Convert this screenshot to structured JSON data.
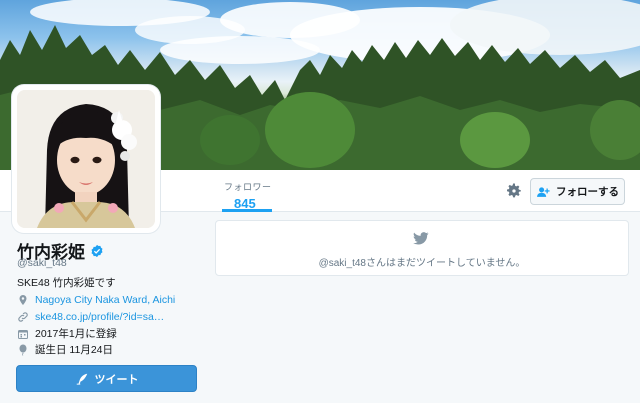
{
  "profile": {
    "name": "竹内彩姫",
    "handle": "@saki_t48",
    "bio": "SKE48 竹内彩姫です",
    "location": "Nagoya City Naka Ward, Aichi",
    "website": "ske48.co.jp/profile/?id=sa…",
    "joined": "2017年1月に登録",
    "birthday": "誕生日 11月24日",
    "verified": true
  },
  "nav": {
    "stats": [
      {
        "label": "フォロワー",
        "value": "845"
      }
    ],
    "follow_label": "フォローする"
  },
  "timeline": {
    "empty_message": "@saki_t48さんはまだツイートしていません。"
  },
  "actions": {
    "tweet_label": "ツイート"
  },
  "colors": {
    "accent": "#1da1f2",
    "link": "#1b95e0",
    "tweet_button": "#3b94d9"
  },
  "icons": [
    "gear-icon",
    "follow-person-icon",
    "verified-badge-icon",
    "location-pin-icon",
    "link-icon",
    "calendar-icon",
    "balloon-icon",
    "quill-icon",
    "twitter-bird-icon"
  ]
}
